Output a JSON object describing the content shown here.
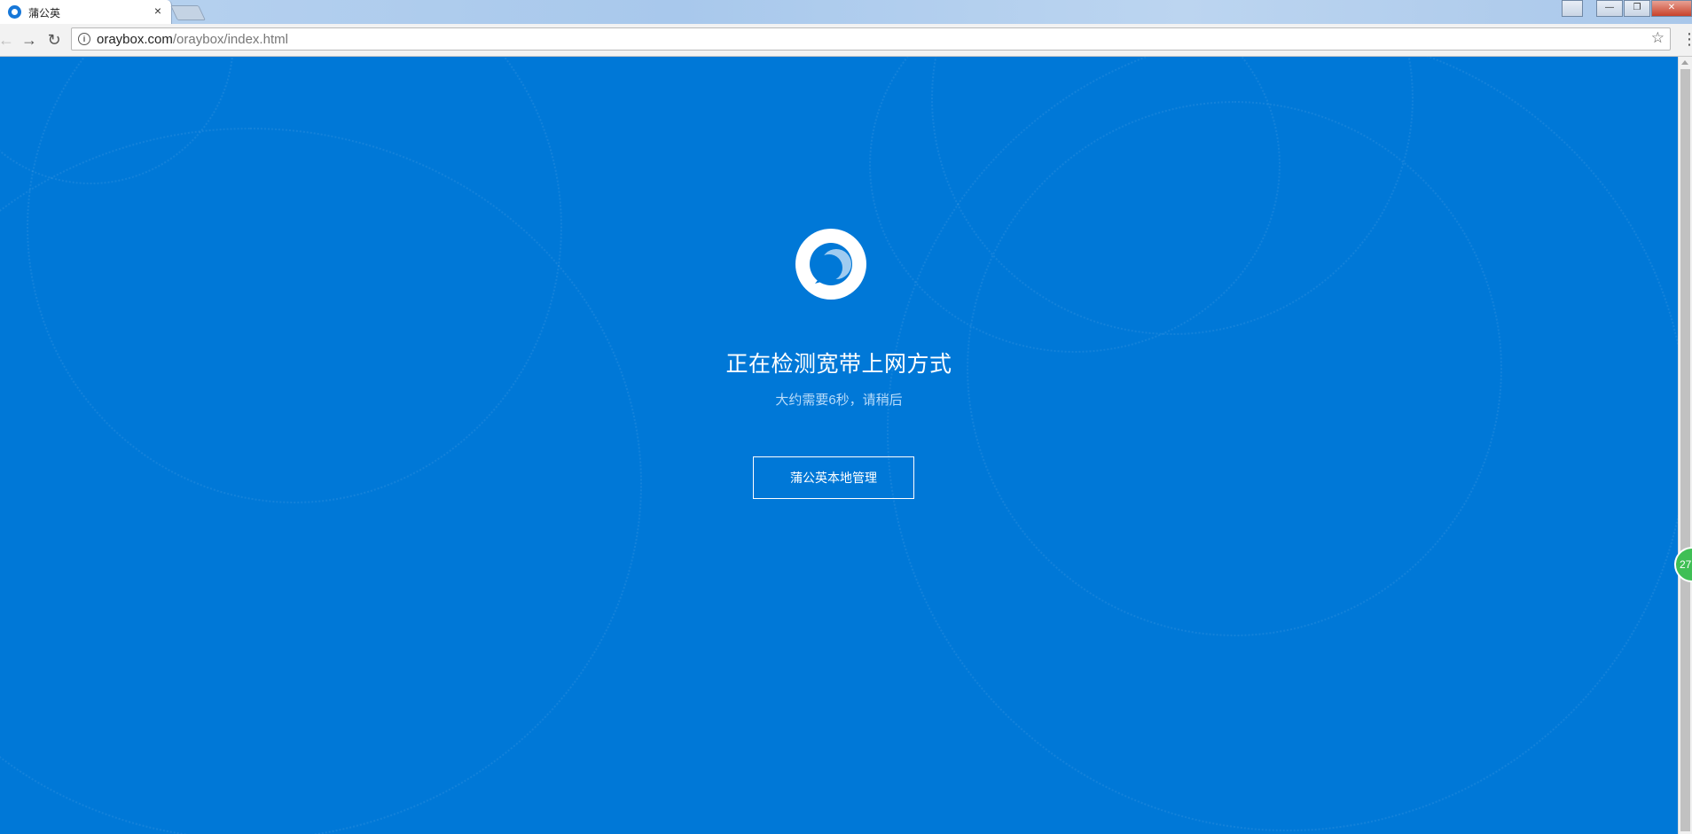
{
  "browser": {
    "tab": {
      "title": "蒲公英",
      "close_glyph": "×",
      "favicon": "pgy-favicon"
    },
    "window_controls": {
      "minimize": "—",
      "restore": "❐",
      "close": "✕"
    },
    "toolbar": {
      "back_glyph": "←",
      "forward_glyph": "→",
      "reload_glyph": "↻",
      "info_glyph": "i",
      "url_host": "oraybox.com",
      "url_path": "/oraybox/index.html",
      "star_glyph": "☆",
      "menu_glyph": "⋮"
    }
  },
  "page": {
    "background_color": "#0078d7",
    "headline": "正在检测宽带上网方式",
    "subline": "大约需要6秒，请稍后",
    "local_manage_button": "蒲公英本地管理",
    "floating_badge_text": "27"
  }
}
